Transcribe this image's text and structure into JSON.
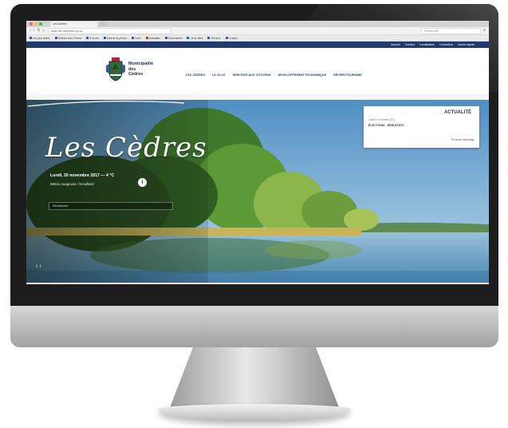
{
  "browser": {
    "tab_title": "Les Cèdres",
    "url": "www.ville.lescedres.qc.ca",
    "search_placeholder": "Rechercher",
    "bookmarks": [
      "Les plus visités",
      "Débuter avec Firefox",
      "À la une",
      "Galerie de photos",
      "Carte",
      "Actualités",
      "Événements",
      "Liens utiles",
      "Services",
      "Contact"
    ]
  },
  "site": {
    "topbar": [
      "Accueil",
      "Contact",
      "Localisation",
      "Connexion",
      "Accès rapide"
    ],
    "logo": [
      "Municipalité",
      "des",
      "Cèdres"
    ],
    "nav": [
      "LES CÈDRES",
      "LA VILLE",
      "SERVICES AUX CITOYENS",
      "DÉVELOPPEMENT ÉCONOMIQUE",
      "RÉCRÉOTOURISME"
    ],
    "hero": {
      "script_title": "Les Cèdres",
      "date": "Lundi, 20 novembre 2017 — 4 °C",
      "weather": "Météo nuageuse / brouillard",
      "info_icon": "i",
      "search_placeholder": "Rechercher"
    },
    "news": {
      "title": "ACTUALITÉ",
      "date": "Lundi 6 novembre 2017",
      "headline": "ÉLECTIONS - RÉSULTATS",
      "more": "En savoir davantage"
    }
  },
  "colors": {
    "brand_navy": "#1f3a6b",
    "bezel": "#1d1d1d"
  }
}
